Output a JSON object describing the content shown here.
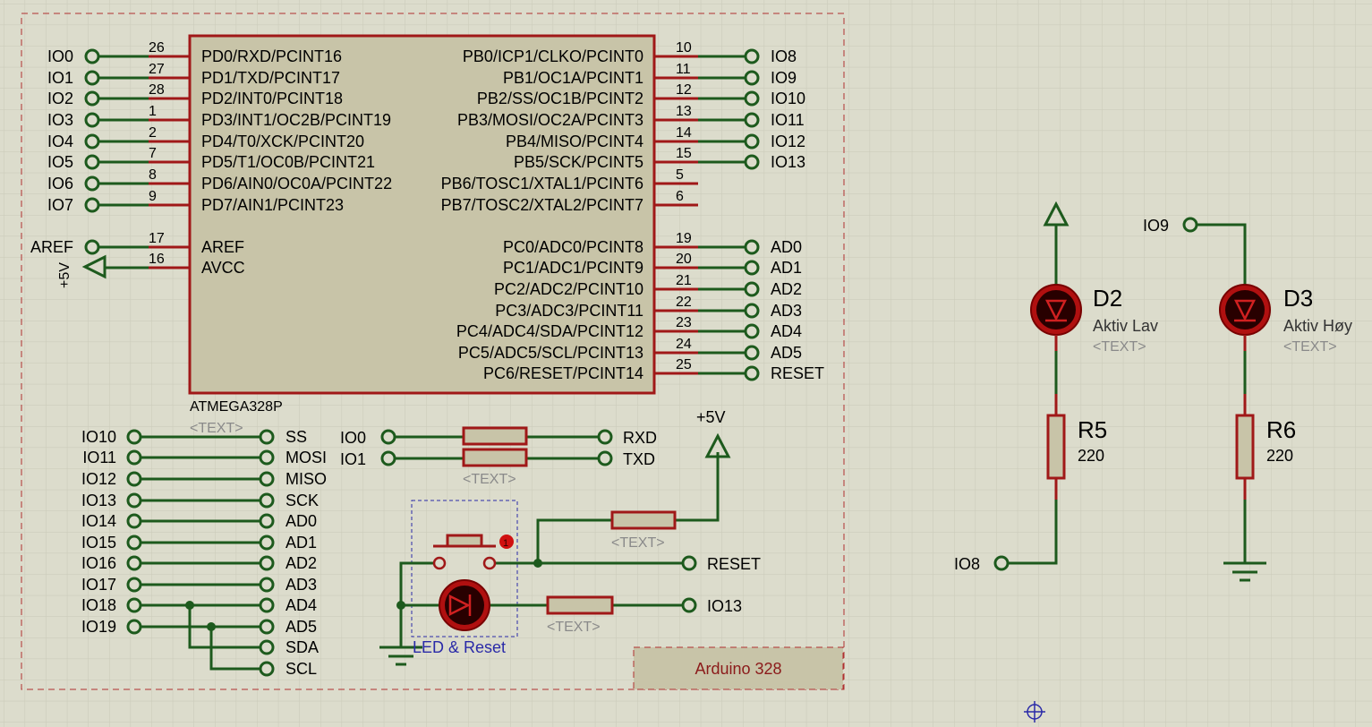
{
  "colors": {
    "background": "#dcdccc",
    "grid": "#c9c9b8",
    "wire": "#1d5a1d",
    "component_outline": "#a01818",
    "component_fill": "#c8c4a8",
    "placeholder_text": "#8a8a8a",
    "sheet_border": "#b03030",
    "selection_box": "#2a2aa8"
  },
  "chip": {
    "name": "ATMEGA328P",
    "text_placeholder": "<TEXT>",
    "left_pins": [
      {
        "net": "IO0",
        "num": "26",
        "label": "PD0/RXD/PCINT16"
      },
      {
        "net": "IO1",
        "num": "27",
        "label": "PD1/TXD/PCINT17"
      },
      {
        "net": "IO2",
        "num": "28",
        "label": "PD2/INT0/PCINT18"
      },
      {
        "net": "IO3",
        "num": "1",
        "label": "PD3/INT1/OC2B/PCINT19"
      },
      {
        "net": "IO4",
        "num": "2",
        "label": "PD4/T0/XCK/PCINT20"
      },
      {
        "net": "IO5",
        "num": "7",
        "label": "PD5/T1/OC0B/PCINT21"
      },
      {
        "net": "IO6",
        "num": "8",
        "label": "PD6/AIN0/OC0A/PCINT22"
      },
      {
        "net": "IO7",
        "num": "9",
        "label": "PD7/AIN1/PCINT23"
      },
      {
        "net": "AREF",
        "num": "17",
        "label": "AREF"
      },
      {
        "net": "+5V",
        "num": "16",
        "label": "AVCC"
      }
    ],
    "right_pins": [
      {
        "net": "IO8",
        "num": "10",
        "label": "PB0/ICP1/CLKO/PCINT0"
      },
      {
        "net": "IO9",
        "num": "11",
        "label": "PB1/OC1A/PCINT1"
      },
      {
        "net": "IO10",
        "num": "12",
        "label": "PB2/SS/OC1B/PCINT2"
      },
      {
        "net": "IO11",
        "num": "13",
        "label": "PB3/MOSI/OC2A/PCINT3"
      },
      {
        "net": "IO12",
        "num": "14",
        "label": "PB4/MISO/PCINT4"
      },
      {
        "net": "IO13",
        "num": "15",
        "label": "PB5/SCK/PCINT5"
      },
      {
        "net": "",
        "num": "5",
        "label": "PB6/TOSC1/XTAL1/PCINT6"
      },
      {
        "net": "",
        "num": "6",
        "label": "PB7/TOSC2/XTAL2/PCINT7"
      },
      {
        "net": "AD0",
        "num": "19",
        "label": "PC0/ADC0/PCINT8"
      },
      {
        "net": "AD1",
        "num": "20",
        "label": "PC1/ADC1/PCINT9"
      },
      {
        "net": "AD2",
        "num": "21",
        "label": "PC2/ADC2/PCINT10"
      },
      {
        "net": "AD3",
        "num": "22",
        "label": "PC3/ADC3/PCINT11"
      },
      {
        "net": "AD4",
        "num": "23",
        "label": "PC4/ADC4/SDA/PCINT12"
      },
      {
        "net": "AD5",
        "num": "24",
        "label": "PC5/ADC5/SCL/PCINT13"
      },
      {
        "net": "RESET",
        "num": "25",
        "label": "PC6/RESET/PCINT14"
      }
    ]
  },
  "alias_map": {
    "left": [
      "IO10",
      "IO11",
      "IO12",
      "IO13",
      "IO14",
      "IO15",
      "IO16",
      "IO17",
      "IO18",
      "IO19"
    ],
    "right": [
      "SS",
      "MOSI",
      "MISO",
      "SCK",
      "AD0",
      "AD1",
      "AD2",
      "AD3",
      "AD4",
      "AD5",
      "SDA",
      "SCL"
    ]
  },
  "serial": {
    "left": [
      "IO0",
      "IO1"
    ],
    "right": [
      "RXD",
      "TXD"
    ],
    "text_placeholder": "<TEXT>"
  },
  "reset_block": {
    "supply": "+5V",
    "reset_label": "RESET",
    "led_net": "IO13",
    "caption": "LED & Reset",
    "pullup_placeholder": "<TEXT>",
    "led_res_placeholder": "<TEXT>"
  },
  "sheet_title": "Arduino 328",
  "d2": {
    "name": "D2",
    "value": "Aktiv Lav",
    "text_placeholder": "<TEXT>",
    "resistor_name": "R5",
    "resistor_value": "220",
    "net": "IO8"
  },
  "d3": {
    "name": "D3",
    "value": "Aktiv Høy",
    "text_placeholder": "<TEXT>",
    "resistor_name": "R6",
    "resistor_value": "220",
    "net": "IO9"
  }
}
